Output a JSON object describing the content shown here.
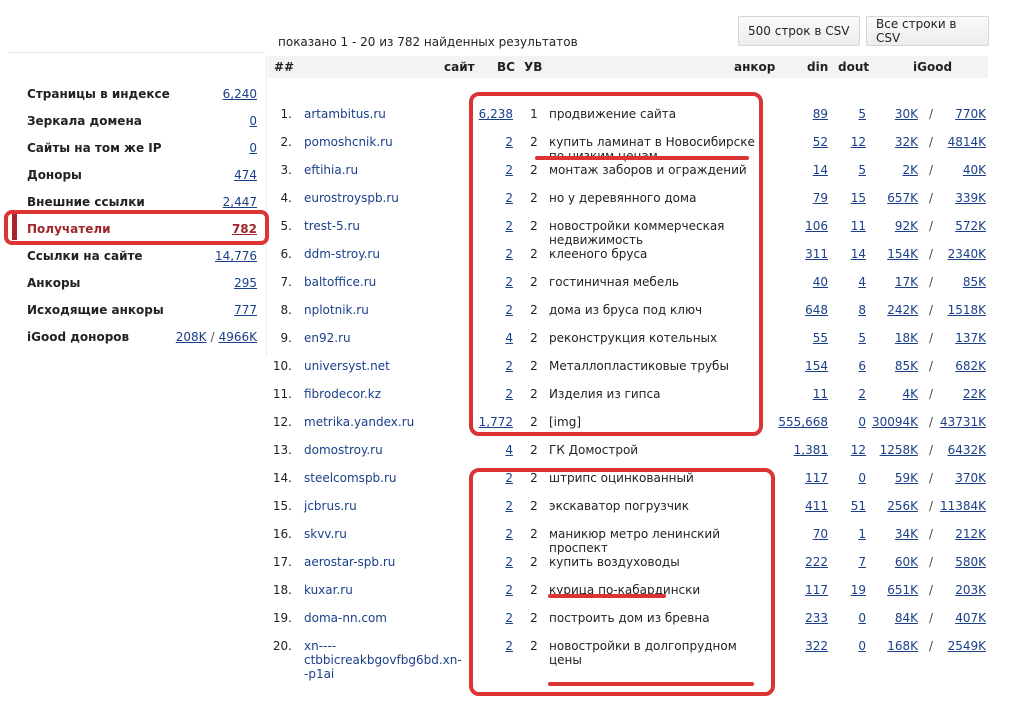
{
  "results_info": "показано 1 - 20 из 782 найденных результатов",
  "buttons": {
    "csv_500": "500 строк в CSV",
    "csv_all": "Все строки в CSV"
  },
  "sidebar": {
    "items": [
      {
        "label": "Страницы в индексе",
        "value": "6,240"
      },
      {
        "label": "Зеркала домена",
        "value": "0"
      },
      {
        "label": "Сайты на том же IP",
        "value": "0"
      },
      {
        "label": "Доноры",
        "value": "474"
      },
      {
        "label": "Внешние ссылки",
        "value": "2,447"
      },
      {
        "label": "Получатели",
        "value": "782",
        "active": true
      },
      {
        "label": "Ссылки на сайте",
        "value": "14,776"
      },
      {
        "label": "Анкоры",
        "value": "295"
      },
      {
        "label": "Исходящие анкоры",
        "value": "777"
      }
    ],
    "igood": {
      "label": "iGood доноров",
      "value1": "208K",
      "sep": "/",
      "value2": "4966K"
    }
  },
  "table": {
    "headers": {
      "num": "##",
      "site": "сайт",
      "bc": "ВС",
      "uv": "УВ",
      "anchor": "анкор",
      "din": "din",
      "dout": "dout",
      "igood": "iGood"
    },
    "rows": [
      {
        "num": "1.",
        "site": "artambitus.ru",
        "bc": "6,238",
        "uv": "1",
        "anchor": "продвижение сайта",
        "din": "89",
        "dout": "5",
        "ig1": "30K",
        "ig2": "770K"
      },
      {
        "num": "2.",
        "site": "pomoshcnik.ru",
        "bc": "2",
        "uv": "2",
        "anchor": "купить ламинат в Новосибирске по низким ценам",
        "din": "52",
        "dout": "12",
        "ig1": "32K",
        "ig2": "4814K"
      },
      {
        "num": "3.",
        "site": "eftihia.ru",
        "bc": "2",
        "uv": "2",
        "anchor": "монтаж заборов и ограждений",
        "din": "14",
        "dout": "5",
        "ig1": "2K",
        "ig2": "40K"
      },
      {
        "num": "4.",
        "site": "eurostroyspb.ru",
        "bc": "2",
        "uv": "2",
        "anchor": "но у деревянного дома",
        "din": "79",
        "dout": "15",
        "ig1": "657K",
        "ig2": "339K"
      },
      {
        "num": "5.",
        "site": "trest-5.ru",
        "bc": "2",
        "uv": "2",
        "anchor": "новостройки коммерческая недвижимость",
        "din": "106",
        "dout": "11",
        "ig1": "92K",
        "ig2": "572K"
      },
      {
        "num": "6.",
        "site": "ddm-stroy.ru",
        "bc": "2",
        "uv": "2",
        "anchor": "клееного бруса",
        "din": "311",
        "dout": "14",
        "ig1": "154K",
        "ig2": "2340K"
      },
      {
        "num": "7.",
        "site": "baltoffice.ru",
        "bc": "2",
        "uv": "2",
        "anchor": "гостиничная мебель",
        "din": "40",
        "dout": "4",
        "ig1": "17K",
        "ig2": "85K"
      },
      {
        "num": "8.",
        "site": "nplotnik.ru",
        "bc": "2",
        "uv": "2",
        "anchor": "дома из бруса под ключ",
        "din": "648",
        "dout": "8",
        "ig1": "242K",
        "ig2": "1518K"
      },
      {
        "num": "9.",
        "site": "en92.ru",
        "bc": "4",
        "uv": "2",
        "anchor": "реконструкция котельных",
        "din": "55",
        "dout": "5",
        "ig1": "18K",
        "ig2": "137K"
      },
      {
        "num": "10.",
        "site": "universyst.net",
        "bc": "2",
        "uv": "2",
        "anchor": "Металлопластиковые трубы",
        "din": "154",
        "dout": "6",
        "ig1": "85K",
        "ig2": "682K"
      },
      {
        "num": "11.",
        "site": "fibrodecor.kz",
        "bc": "2",
        "uv": "2",
        "anchor": "Изделия из гипса",
        "din": "11",
        "dout": "2",
        "ig1": "4K",
        "ig2": "22K"
      },
      {
        "num": "12.",
        "site": "metrika.yandex.ru",
        "bc": "1,772",
        "uv": "2",
        "anchor": "[img]",
        "din": "555,668",
        "dout": "0",
        "ig1": "30094K",
        "ig2": "43731K"
      },
      {
        "num": "13.",
        "site": "domostroy.ru",
        "bc": "4",
        "uv": "2",
        "anchor": "ГК Домострой",
        "din": "1,381",
        "dout": "12",
        "ig1": "1258K",
        "ig2": "6432K"
      },
      {
        "num": "14.",
        "site": "steelcomspb.ru",
        "bc": "2",
        "uv": "2",
        "anchor": "штрипс оцинкованный",
        "din": "117",
        "dout": "0",
        "ig1": "59K",
        "ig2": "370K"
      },
      {
        "num": "15.",
        "site": "jcbrus.ru",
        "bc": "2",
        "uv": "2",
        "anchor": "экскаватор погрузчик",
        "din": "411",
        "dout": "51",
        "ig1": "256K",
        "ig2": "11384K"
      },
      {
        "num": "16.",
        "site": "skvv.ru",
        "bc": "2",
        "uv": "2",
        "anchor": "маникюр метро ленинский проспект",
        "din": "70",
        "dout": "1",
        "ig1": "34K",
        "ig2": "212K"
      },
      {
        "num": "17.",
        "site": "aerostar-spb.ru",
        "bc": "2",
        "uv": "2",
        "anchor": "купить воздуховоды",
        "din": "222",
        "dout": "7",
        "ig1": "60K",
        "ig2": "580K"
      },
      {
        "num": "18.",
        "site": "kuxar.ru",
        "bc": "2",
        "uv": "2",
        "anchor": "курица по-кабардински",
        "din": "117",
        "dout": "19",
        "ig1": "651K",
        "ig2": "203K"
      },
      {
        "num": "19.",
        "site": "doma-nn.com",
        "bc": "2",
        "uv": "2",
        "anchor": "построить дом из бревна",
        "din": "233",
        "dout": "0",
        "ig1": "84K",
        "ig2": "407K"
      },
      {
        "num": "20.",
        "site": "xn----ctbbicreakbgovfbg6bd.xn--p1ai",
        "bc": "2",
        "uv": "2",
        "anchor": "новостройки в долгопрудном цены",
        "din": "322",
        "dout": "0",
        "ig1": "168K",
        "ig2": "2549K"
      }
    ],
    "slash": "/"
  },
  "colors": {
    "link": "#1a3f8a",
    "active": "#a0262c",
    "highlight": "#dc3335",
    "header_bg": "#f3f3f3"
  }
}
